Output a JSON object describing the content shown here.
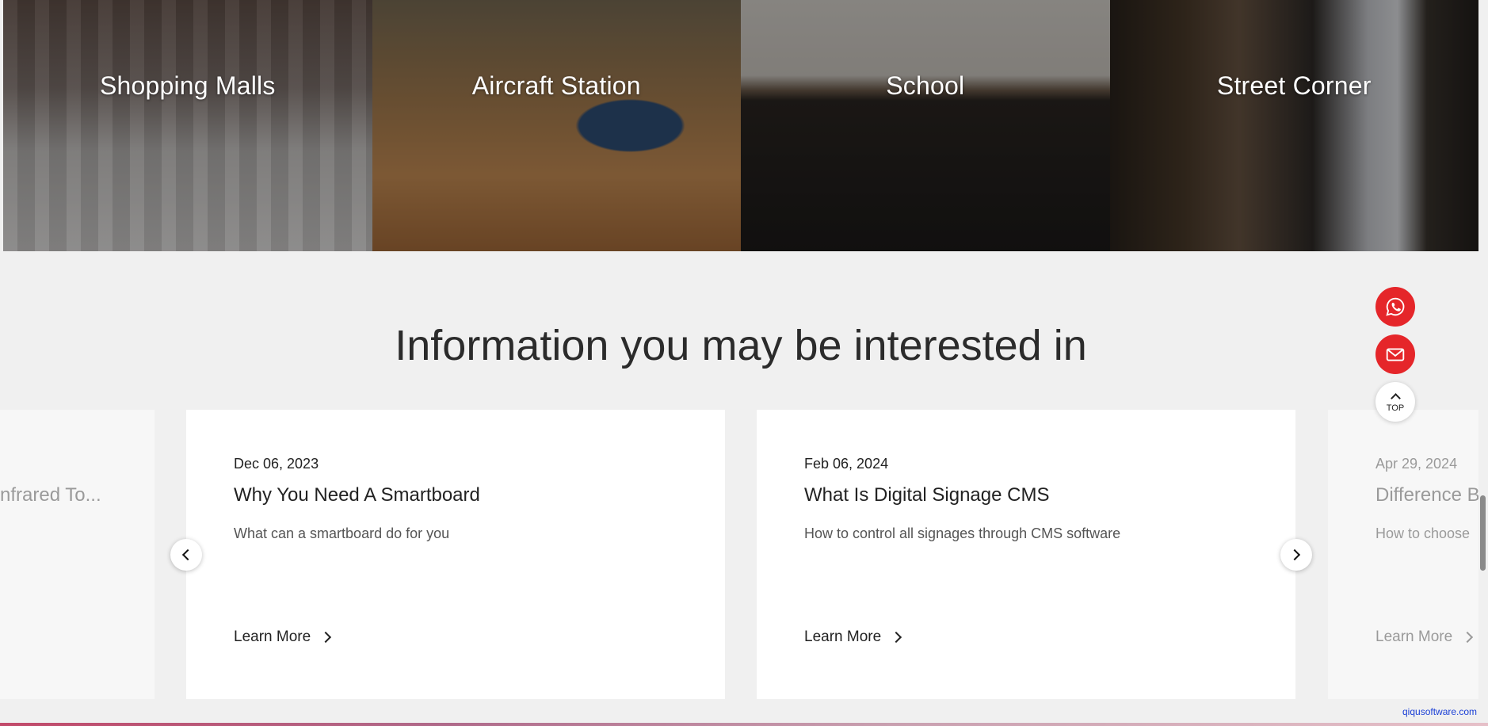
{
  "scenes": [
    {
      "label": "Shopping Malls"
    },
    {
      "label": "Aircraft Station"
    },
    {
      "label": "School"
    },
    {
      "label": "Street Corner"
    }
  ],
  "section_title": "Information you may be interested in",
  "cards": {
    "left_stub": {
      "title": "nfrared To..."
    },
    "items": [
      {
        "date": "Dec 06, 2023",
        "title": "Why You Need A Smartboard",
        "desc": "What can a smartboard do for you",
        "learn": "Learn More"
      },
      {
        "date": "Feb 06, 2024",
        "title": "What Is Digital Signage CMS",
        "desc": "How to control all signages through CMS software",
        "learn": "Learn More"
      }
    ],
    "right_stub": {
      "date": "Apr 29, 2024",
      "title": "Difference Be",
      "desc": "How to choose",
      "learn": "Learn More"
    }
  },
  "floating": {
    "top_label": "TOP"
  },
  "watermark": "qiqusoftware.com",
  "colors": {
    "accent": "#e5262a",
    "background": "#f0f0f0"
  },
  "icons": {
    "whatsapp": "whatsapp-icon",
    "mail": "mail-icon"
  }
}
